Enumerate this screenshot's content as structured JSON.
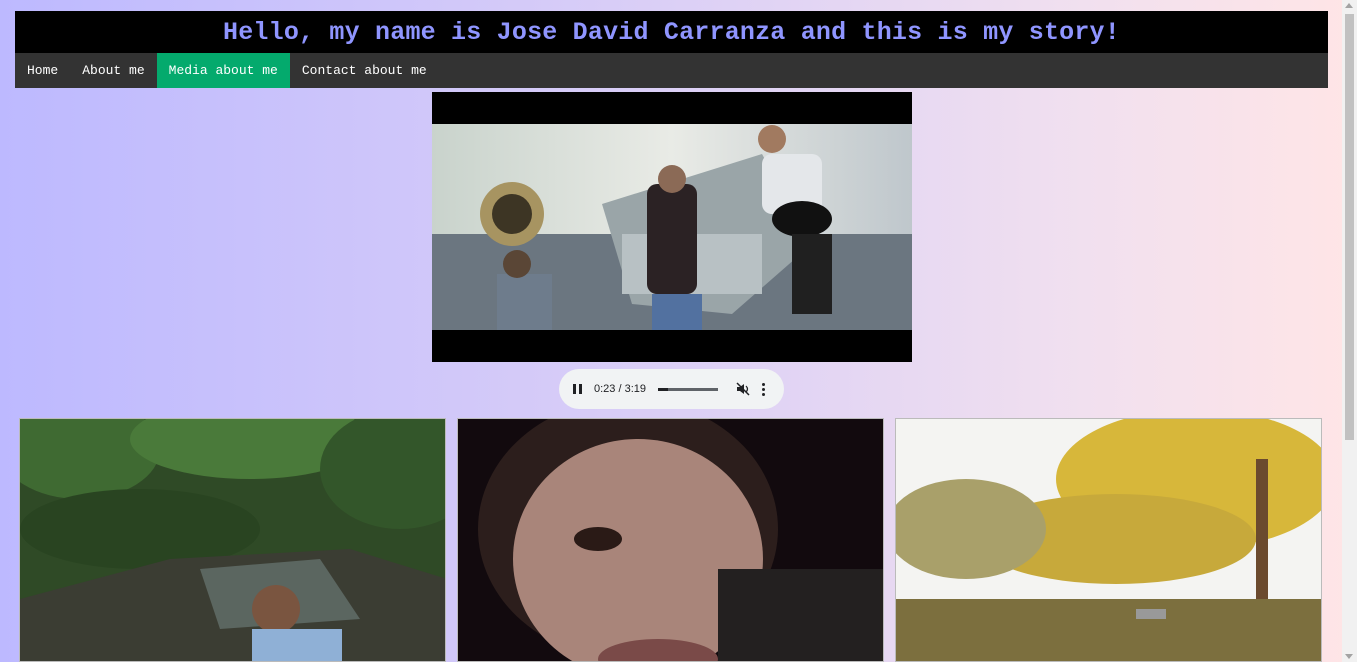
{
  "header": {
    "title": "Hello, my name is Jose David Carranza and this is my story!"
  },
  "nav": {
    "items": [
      {
        "label": "Home",
        "active": false
      },
      {
        "label": "About me",
        "active": false
      },
      {
        "label": "Media about me",
        "active": true
      },
      {
        "label": "Contact about me",
        "active": false
      }
    ]
  },
  "audio_player": {
    "state": "playing",
    "time": "0:23 / 3:19",
    "progress": 0.16,
    "muted": true,
    "icons": [
      "pause-icon",
      "mute-icon",
      "more-options-icon"
    ]
  },
  "colors": {
    "title": "#8f95ff",
    "nav_bg": "#333333",
    "nav_active": "#04aa6d",
    "banner_bg": "#000000"
  }
}
